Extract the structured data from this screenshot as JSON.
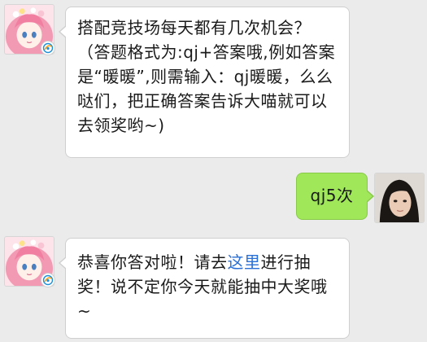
{
  "messages": [
    {
      "side": "left",
      "text": "搭配竞技场每天都有几次机会？（答题格式为:qj+答案哦,例如答案是“暖暖”,则需输入：qj暖暖，么么哒们，把正确答案告诉大喵就可以去领奖哟~)"
    },
    {
      "side": "right",
      "text": "qj5次"
    },
    {
      "side": "left",
      "text_before_link": "恭喜你答对啦！请去",
      "link_text": "这里",
      "text_after_link": "进行抽奖！说不定你今天就能抽中大奖哦~"
    }
  ],
  "colors": {
    "background": "#ebebeb",
    "bubble_incoming": "#ffffff",
    "bubble_outgoing": "#a0e75a",
    "link": "#2a6fd6"
  },
  "icons": {
    "game_avatar": "anime-girl-avatar",
    "platform_badge": "tencent-game-badge",
    "user_avatar": "user-photo-avatar"
  }
}
